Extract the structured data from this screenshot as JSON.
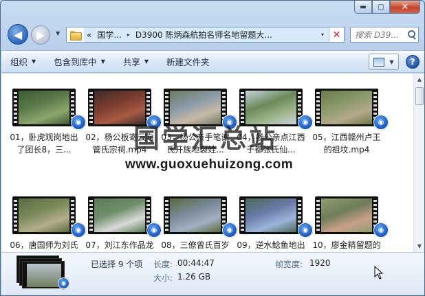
{
  "window": {
    "caption": {
      "minimize": "▬",
      "maximize": "□",
      "close": "✕"
    }
  },
  "address": {
    "crumbs": [
      "«",
      "国学...",
      "▸",
      "D3900 陈炳森航拍名师名地留题大..."
    ],
    "dropdown": "▾",
    "stop": "✕"
  },
  "search": {
    "placeholder": "搜索 D39..."
  },
  "toolbar": {
    "organize": "组织",
    "include_library": "包含到库中",
    "share": "共享",
    "new_folder": "新建文件夹"
  },
  "files": [
    {
      "label": "01，卧虎观岗地出了团长8，三...",
      "colors": [
        "#5b7a4a",
        "#8ea66e",
        "#3c5a35"
      ]
    },
    {
      "label": "02，杨公板寄云向管氏宗祠.mp4",
      "colors": [
        "#7a3d30",
        "#a85a44",
        "#3d2b28"
      ]
    },
    {
      "label": "03，杨公亲手笔谢氏开族地裂姓...",
      "colors": [
        "#8a9aa8",
        "#c7b9a7",
        "#6c7a62"
      ]
    },
    {
      "label": "04，杨公亲点江西于都张氏仙...",
      "colors": [
        "#6a8a5a",
        "#9fb58c",
        "#c8d3dc"
      ]
    },
    {
      "label": "05，江西赣州卢王的祖坟.mp4",
      "colors": [
        "#8a9a6a",
        "#b4a98a",
        "#6c7a4a"
      ]
    },
    {
      "label": "06，唐国师为刘氏所扦的...",
      "colors": [
        "#7a8a5a",
        "#b6ad8c",
        "#5a6b42"
      ]
    },
    {
      "label": "07，刘江东作品龙泉地...",
      "colors": [
        "#6f8f6a",
        "#d9d9d9",
        "#5a7a55"
      ]
    },
    {
      "label": "08，三僚曾氏百岁龙门地...",
      "colors": [
        "#7a8a9a",
        "#a1b1c1",
        "#58693f"
      ]
    },
    {
      "label": "09，逆水鲶鱼地出了十大...",
      "colors": [
        "#6a7aa8",
        "#9cb5d8",
        "#4a6a5a"
      ]
    },
    {
      "label": "10，廖金精留题的马鞍...",
      "colors": [
        "#6f7d5a",
        "#c8a08a",
        "#8f9f70"
      ]
    }
  ],
  "watermark": {
    "cn": "国学汇总站",
    "en": "www.guoxuehuizong.com"
  },
  "details": {
    "selection": "已选择 9 个项",
    "duration_label": "长度:",
    "duration_value": "00:44:47",
    "size_label": "大小:",
    "size_value": "1.26 GB",
    "framewidth_label": "帧宽度:",
    "framewidth_value": "1920"
  },
  "icons": {
    "back": "back-arrow-icon",
    "forward": "forward-arrow-icon",
    "folder": "folder-icon",
    "search": "search-icon",
    "help": "help-icon",
    "media": "windows-media-player-icon"
  },
  "colors": {
    "toolbar_bg": "#dce8f6",
    "content_bg": "#ffffff",
    "accent": "#1751b5"
  }
}
